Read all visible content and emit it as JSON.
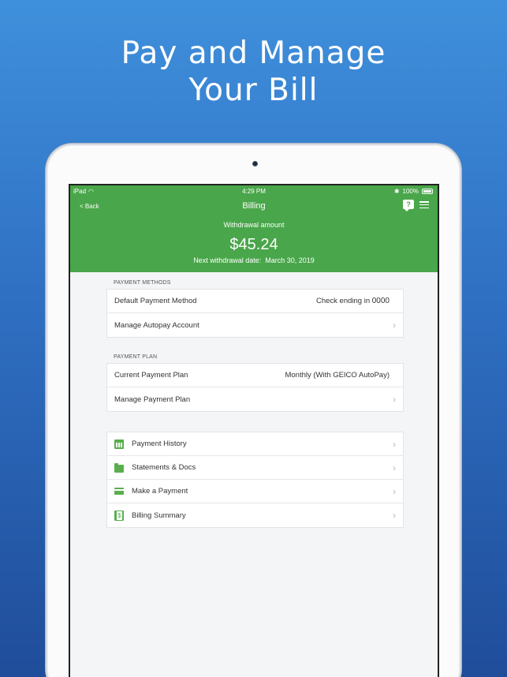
{
  "promo": {
    "line1": "Pay and Manage",
    "line2": "Your Bill"
  },
  "status_bar": {
    "device": "iPad",
    "time": "4:29 PM",
    "battery": "100%"
  },
  "header": {
    "back_label": "< Back",
    "title": "Billing",
    "help_icon": "?",
    "withdrawal_label": "Withdrawal amount",
    "withdrawal_amount": "$45.24",
    "next_date_label": "Next withdrawal date:",
    "next_date_value": "March 30, 2019"
  },
  "payment_methods": {
    "section_label": "PAYMENT METHODS",
    "default_label": "Default Payment Method",
    "default_value_prefix": "Check ending in",
    "default_value_digits": "0000",
    "manage_autopay_label": "Manage Autopay Account"
  },
  "payment_plan": {
    "section_label": "PAYMENT PLAN",
    "current_label": "Current Payment Plan",
    "current_value": "Monthly (With GEICO AutoPay)",
    "manage_label": "Manage Payment Plan"
  },
  "links": [
    {
      "label": "Payment History",
      "icon": "calendar-icon"
    },
    {
      "label": "Statements & Docs",
      "icon": "folder-icon"
    },
    {
      "label": "Make a Payment",
      "icon": "credit-card-icon"
    },
    {
      "label": "Billing Summary",
      "icon": "bill-icon"
    }
  ],
  "colors": {
    "header_green": "#49a64a",
    "icon_green": "#5aae4e",
    "background_blue_top": "#3f90dc",
    "background_blue_bottom": "#1f4d9a"
  }
}
